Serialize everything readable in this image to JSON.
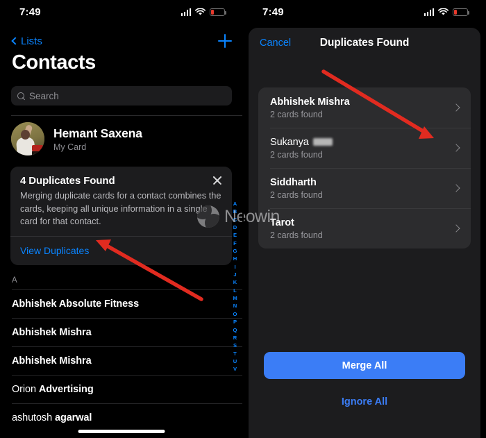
{
  "accent": {
    "ios_blue": "#0a84ff",
    "button_blue": "#3b7df6",
    "arrow_red": "#e12b20",
    "battery_red": "#e8392c"
  },
  "left_panel": {
    "statusbar": {
      "time": "7:49",
      "cellular_icon": "cellular-bars-icon",
      "wifi_icon": "wifi-icon",
      "battery_icon": "battery-low-icon"
    },
    "nav": {
      "back_label": "Lists",
      "back_icon": "chevron-left-icon",
      "add_icon": "plus-icon"
    },
    "page_title": "Contacts",
    "search": {
      "placeholder": "Search",
      "icon": "search-icon"
    },
    "my_card": {
      "name": "Hemant Saxena",
      "subtitle": "My Card",
      "avatar": "contact-photo-avatar"
    },
    "duplicates_banner": {
      "title": "4 Duplicates Found",
      "body": "Merging duplicate cards for a contact combines the cards, keeping all unique information in a single card for that contact.",
      "link": "View Duplicates",
      "close_icon": "close-icon"
    },
    "section_letter": "A",
    "contacts": [
      {
        "first": "Abhishek",
        "last": "Absolute Fitness",
        "bold": "both"
      },
      {
        "first": "Abhishek",
        "last": "Mishra",
        "bold": "both"
      },
      {
        "first": "Abhishek",
        "last": "Mishra",
        "bold": "both"
      },
      {
        "first": "Orion",
        "last": "Advertising",
        "bold": "last"
      },
      {
        "first": "ashutosh",
        "last": "agarwal",
        "bold": "last"
      }
    ],
    "index_letters": [
      "A",
      "B",
      "C",
      "D",
      "E",
      "F",
      "G",
      "H",
      "I",
      "J",
      "K",
      "L",
      "M",
      "N",
      "O",
      "P",
      "Q",
      "R",
      "S",
      "T",
      "U",
      "V"
    ]
  },
  "right_panel": {
    "statusbar": {
      "time": "7:49",
      "cellular_icon": "cellular-bars-icon",
      "wifi_icon": "wifi-icon",
      "battery_icon": "battery-low-icon"
    },
    "sheet": {
      "cancel_label": "Cancel",
      "title": "Duplicates Found",
      "rows": [
        {
          "name": "Abhishek Mishra",
          "sub": "2 cards found",
          "redacted": false,
          "chevron": "chevron-right-icon"
        },
        {
          "name": "Sukanya",
          "sub": "2 cards found",
          "redacted": true,
          "chevron": "chevron-right-icon"
        },
        {
          "name": "Siddharth",
          "sub": "2 cards found",
          "redacted": false,
          "chevron": "chevron-right-icon"
        },
        {
          "name": "Tarot",
          "sub": "2 cards found",
          "redacted": false,
          "chevron": "chevron-right-icon"
        }
      ],
      "merge_label": "Merge All",
      "ignore_label": "Ignore All"
    }
  },
  "watermark": {
    "text": "Neowin",
    "logo": "neowin-logo-icon"
  }
}
